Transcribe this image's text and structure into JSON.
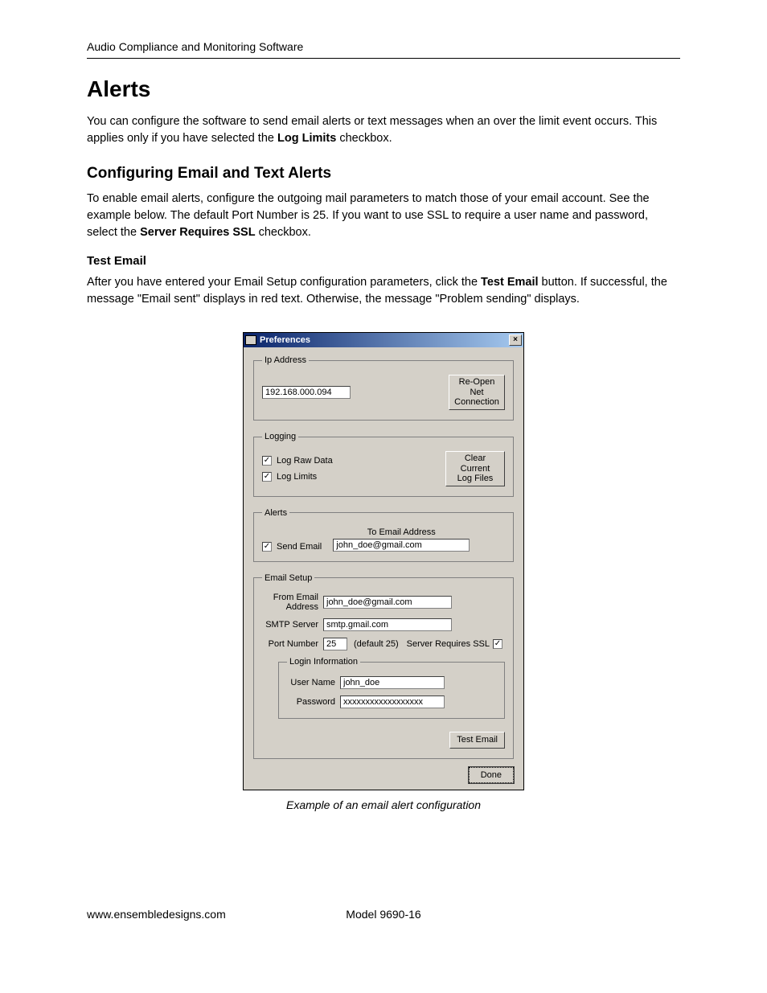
{
  "header": "Audio Compliance and Monitoring Software",
  "h1": "Alerts",
  "p1a": "You can configure the software to send email alerts or text messages when an over the limit event occurs. This applies only if you have selected the ",
  "p1b": "Log Limits",
  "p1c": " checkbox.",
  "h2": "Configuring Email and Text Alerts",
  "p2a": "To enable email alerts, configure the outgoing mail parameters to match those of your email account. See the example below. The default Port Number is 25. If you want to use SSL to require a user name and password, select the ",
  "p2b": "Server Requires SSL",
  "p2c": " checkbox.",
  "h3": "Test Email",
  "p3a": "After you have entered your Email Setup configuration parameters, click the ",
  "p3b": "Test Email",
  "p3c": " button. If successful, the message \"Email sent\" displays in red text. Otherwise, the message \"Problem sending\" displays.",
  "caption": "Example of an email alert configuration",
  "footer": {
    "left": "www.ensembledesigns.com",
    "mid": "Model 9690-16"
  },
  "dialog": {
    "title": "Preferences",
    "close": "×",
    "ip": {
      "legend": "Ip Address",
      "value": "192.168.000.094",
      "btn1": "Re-Open Net",
      "btn2": "Connection"
    },
    "logging": {
      "legend": "Logging",
      "opt1": "Log Raw Data",
      "opt2": "Log Limits",
      "btn1": "Clear Current",
      "btn2": "Log Files"
    },
    "alerts": {
      "legend": "Alerts",
      "chk": "Send Email",
      "tolabel": "To Email Address",
      "toval": "john_doe@gmail.com"
    },
    "email": {
      "legend": "Email Setup",
      "fromlab1": "From Email",
      "fromlab2": "Address",
      "fromval": "john_doe@gmail.com",
      "smtplab": "SMTP Server",
      "smtpval": "smtp.gmail.com",
      "portlab": "Port Number",
      "portval": "25",
      "portdef": "(default 25)",
      "ssllab": "Server Requires SSL",
      "login": {
        "legend": "Login Information",
        "userlab": "User Name",
        "userval": "john_doe",
        "pwdlab": "Password",
        "pwdval": "xxxxxxxxxxxxxxxxxx"
      },
      "testbtn": "Test Email"
    },
    "done": "Done"
  }
}
